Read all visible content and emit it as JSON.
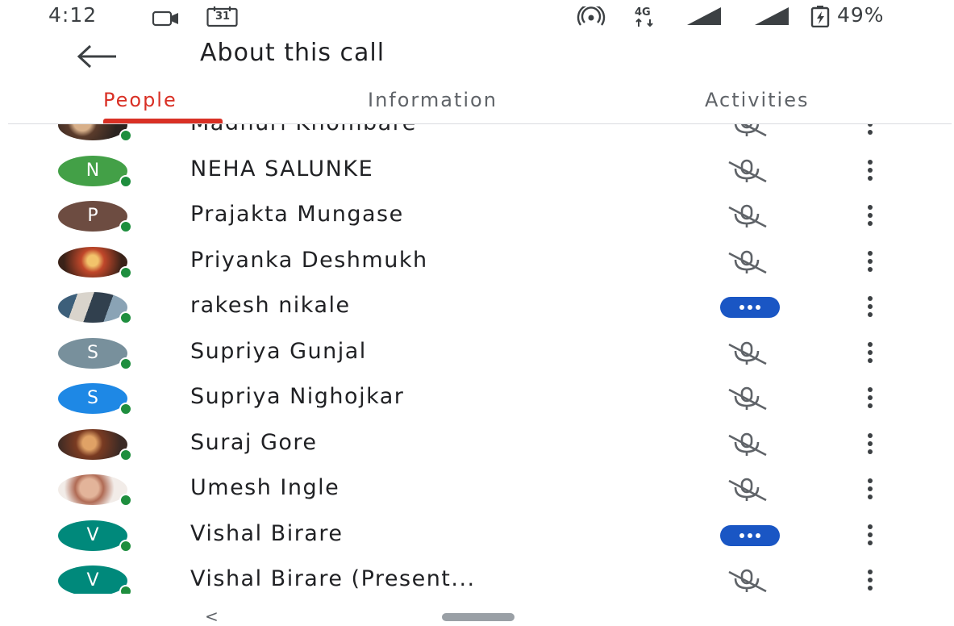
{
  "status_bar": {
    "time": "4:12",
    "calendar_day": "31",
    "network": "4G",
    "battery_percent": "49%",
    "icons": [
      "video-camera-icon",
      "calendar-icon",
      "hotspot-icon",
      "network-4g-icon",
      "signal-icon",
      "signal-icon",
      "battery-saver-icon"
    ]
  },
  "header": {
    "title": "About this call",
    "back_icon": "arrow-left-icon"
  },
  "tabs": [
    {
      "label": "People",
      "active": true
    },
    {
      "label": "Information",
      "active": false
    },
    {
      "label": "Activities",
      "active": false
    }
  ],
  "participants": [
    {
      "name": "Madhuri Khombare",
      "avatar_letter": "",
      "avatar_type": "photo",
      "status": "muted"
    },
    {
      "name": "NEHA SALUNKE",
      "avatar_letter": "N",
      "avatar_color": "#43a047",
      "avatar_type": "letter",
      "status": "muted"
    },
    {
      "name": "Prajakta Mungase",
      "avatar_letter": "P",
      "avatar_color": "#6d4c41",
      "avatar_type": "letter",
      "status": "muted"
    },
    {
      "name": "Priyanka Deshmukh",
      "avatar_letter": "",
      "avatar_type": "photo",
      "status": "muted"
    },
    {
      "name": "rakesh nikale",
      "avatar_letter": "",
      "avatar_type": "photo",
      "status": "speaking"
    },
    {
      "name": "Supriya Gunjal",
      "avatar_letter": "S",
      "avatar_color": "#78909c",
      "avatar_type": "letter",
      "status": "muted"
    },
    {
      "name": "Supriya Nighojkar",
      "avatar_letter": "S",
      "avatar_color": "#1e88e5",
      "avatar_type": "letter",
      "status": "muted"
    },
    {
      "name": "Suraj Gore",
      "avatar_letter": "",
      "avatar_type": "photo",
      "status": "muted"
    },
    {
      "name": "Umesh Ingle",
      "avatar_letter": "",
      "avatar_type": "photo",
      "status": "muted"
    },
    {
      "name": "Vishal Birare",
      "avatar_letter": "V",
      "avatar_color": "#00897b",
      "avatar_type": "letter",
      "status": "speaking"
    },
    {
      "name": "Vishal Birare (Present...",
      "avatar_letter": "V",
      "avatar_color": "#00897b",
      "avatar_type": "letter",
      "status": "muted"
    }
  ],
  "colors": {
    "accent_red": "#d93025",
    "speaking_blue": "#1a56c4",
    "online_green": "#1e8e3e"
  },
  "nav_bar": {
    "back_glyph": "<",
    "home_icon": "home-pill-icon"
  }
}
